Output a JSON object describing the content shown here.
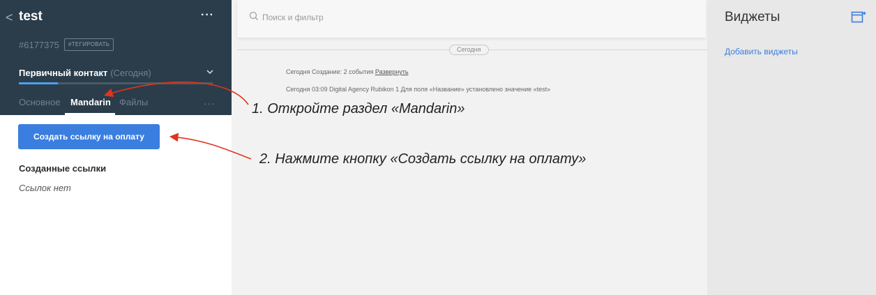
{
  "lead": {
    "back_glyph": "<",
    "title": "test",
    "menu_glyph": "···",
    "id": "#6177375",
    "tag_button": "#ТЕГИРОВАТЬ",
    "stage_name": "Первичный контакт",
    "stage_date": "(Сегодня)",
    "stage_chevron": "⌄",
    "stage_progress": 0.2
  },
  "tabs": [
    {
      "label": "Основное",
      "active": false
    },
    {
      "label": "Mandarin",
      "active": true
    },
    {
      "label": "Файлы",
      "active": false
    }
  ],
  "tabs_more": "···",
  "mandarin": {
    "create_button": "Создать ссылку на оплату",
    "section_title": "Созданные ссылки",
    "empty_text": "Ссылок нет"
  },
  "feed": {
    "search_placeholder": "Поиск и фильтр",
    "day_label": "Сегодня",
    "event1_text": "Сегодня Создание: 2 события ",
    "event1_link": "Развернуть",
    "event2_text": "Сегодня 03:09 Digital Agency Rubikon 1 Для поля «Название» установлено значение «test»"
  },
  "widgets": {
    "title": "Виджеты",
    "add_link": "Добавить виджеты"
  },
  "annotations": {
    "step1": "1. Откройте раздел «Mandarin»",
    "step2": "2. Нажмите кнопку «Создать ссылку на оплату»",
    "arrow_color": "#e0341e"
  },
  "colors": {
    "header_bg": "#2b3d4a",
    "accent": "#3a7ee0",
    "progress": "#4a9ff0"
  }
}
